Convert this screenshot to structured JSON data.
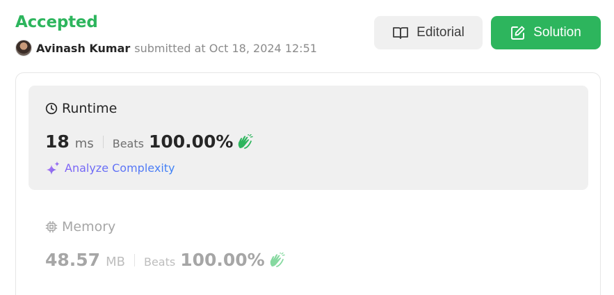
{
  "header": {
    "status": "Accepted",
    "user_name": "Avinash Kumar",
    "submitted_text": "submitted at Oct 18, 2024 12:51"
  },
  "actions": {
    "editorial_label": "Editorial",
    "solution_label": "Solution"
  },
  "runtime": {
    "title": "Runtime",
    "value": "18",
    "unit": "ms",
    "beats_label": "Beats",
    "beats_value": "100.00%",
    "analyze_label": "Analyze Complexity"
  },
  "memory": {
    "title": "Memory",
    "value": "48.57",
    "unit": "MB",
    "beats_label": "Beats",
    "beats_value": "100.00%"
  },
  "colors": {
    "accent_green": "#2db55d",
    "panel_bg": "#f0f0f0",
    "muted_text": "#a6a6a6"
  },
  "icons": {
    "editorial": "book-open-icon",
    "solution": "edit-square-icon",
    "runtime": "clock-icon",
    "memory": "chip-icon",
    "analyze": "sparkles-icon",
    "beats": "clapping-hands-icon"
  }
}
